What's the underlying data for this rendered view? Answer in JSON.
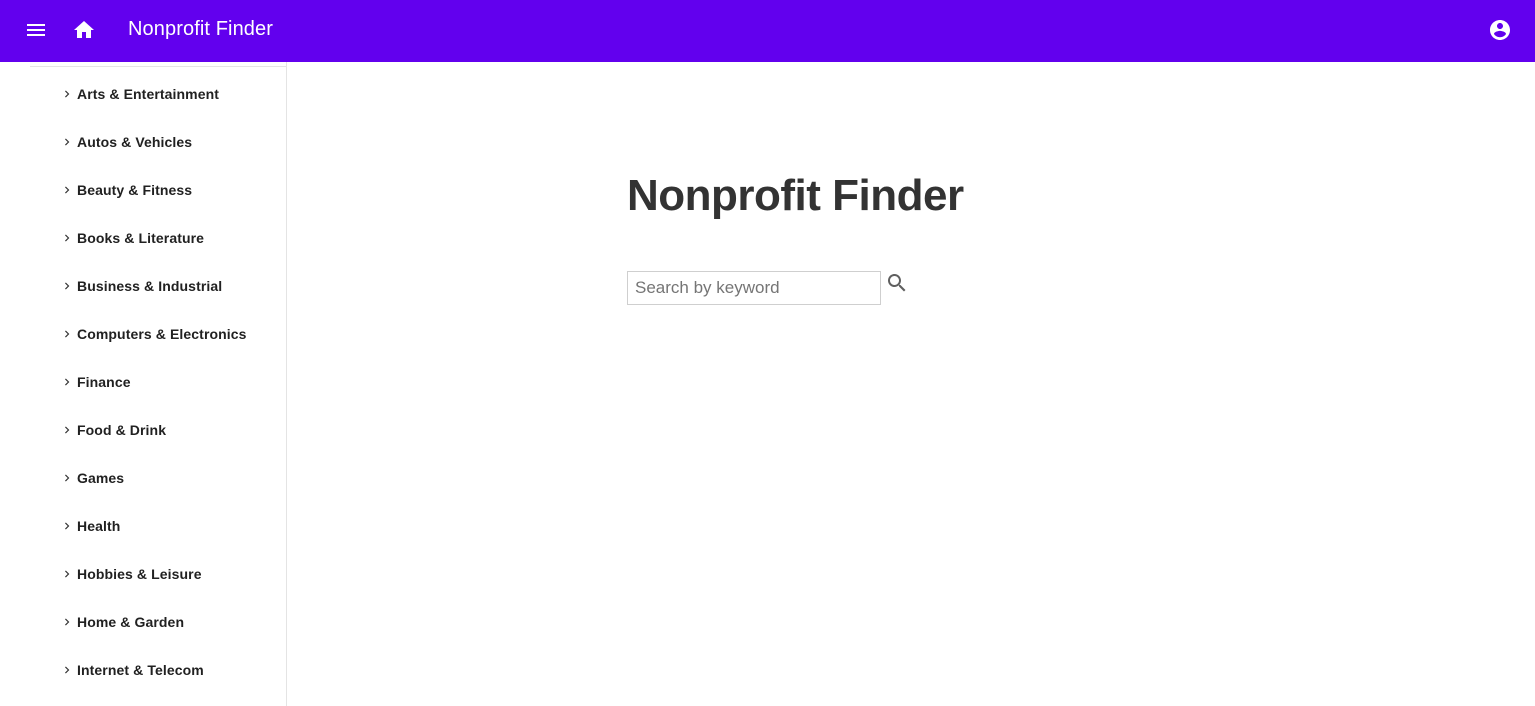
{
  "appbar": {
    "title": "Nonprofit Finder",
    "menu_icon": "menu-icon",
    "home_icon": "home-icon",
    "account_icon": "account-circle-icon",
    "background_color": "#6200ee"
  },
  "sidebar": {
    "chevron_icon": "chevron-right-icon",
    "categories": [
      {
        "label": "Arts & Entertainment"
      },
      {
        "label": "Autos & Vehicles"
      },
      {
        "label": "Beauty & Fitness"
      },
      {
        "label": "Books & Literature"
      },
      {
        "label": "Business & Industrial"
      },
      {
        "label": "Computers & Electronics"
      },
      {
        "label": "Finance"
      },
      {
        "label": "Food & Drink"
      },
      {
        "label": "Games"
      },
      {
        "label": "Health"
      },
      {
        "label": "Hobbies & Leisure"
      },
      {
        "label": "Home & Garden"
      },
      {
        "label": "Internet & Telecom"
      }
    ]
  },
  "main": {
    "heading": "Nonprofit Finder",
    "search": {
      "placeholder": "Search by keyword",
      "value": "",
      "icon": "search-icon"
    }
  }
}
